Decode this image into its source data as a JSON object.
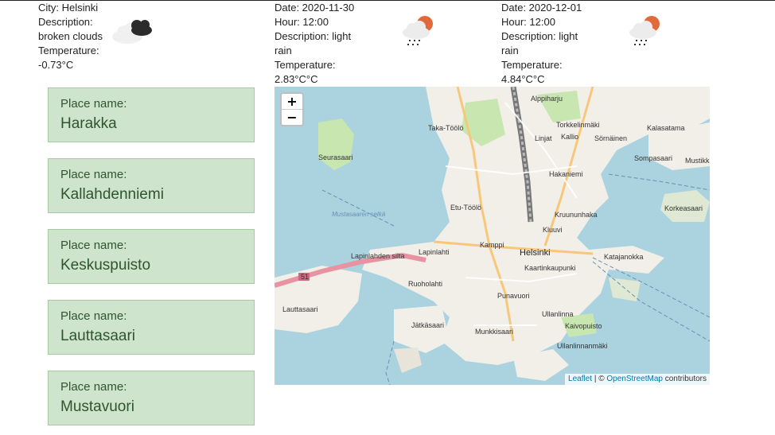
{
  "current": {
    "city": "City: Helsinki",
    "desc_label": "Description:",
    "desc_value": "broken clouds",
    "temp_label": "Temperature:",
    "temp_value": "-0.73°C",
    "icon": "broken-clouds-icon"
  },
  "forecast": [
    {
      "date": "Date: 2020-11-30",
      "hour": "Hour: 12:00",
      "desc_line1": "Description: light",
      "desc_line2": "rain",
      "temp_label": "Temperature:",
      "temp_value": "2.83°C°C",
      "icon": "light-rain-icon"
    },
    {
      "date": "Date: 2020-12-01",
      "hour": "Hour: 12:00",
      "desc_line1": "Description: light",
      "desc_line2": "rain",
      "temp_label": "Temperature:",
      "temp_value": "4.84°C°C",
      "icon": "light-rain-icon"
    }
  ],
  "places": [
    {
      "label": "Place name:",
      "name": "Harakka"
    },
    {
      "label": "Place name:",
      "name": "Kallahdenniemi"
    },
    {
      "label": "Place name:",
      "name": "Keskuspuisto"
    },
    {
      "label": "Place name:",
      "name": "Lauttasaari"
    },
    {
      "label": "Place name:",
      "name": "Mustavuori"
    }
  ],
  "map": {
    "zoom_in": "+",
    "zoom_out": "−",
    "attribution_leaflet": "Leaflet",
    "attribution_sep": " | © ",
    "attribution_osm": "OpenStreetMap",
    "attribution_tail": " contributors",
    "labels": {
      "alppiharju": "Alppiharju",
      "taka_toolo": "Taka-Töölö",
      "torkkelinmaki": "Torkkelinmäki",
      "kalasatama": "Kalasatama",
      "linjat": "Linjat",
      "kallio": "Kallio",
      "sornainen": "Sörnäinen",
      "seurasaari": "Seurasaari",
      "sompasaari": "Sompasaari",
      "mustikkamaa": "Mustikka",
      "hakaniemi": "Hakaniemi",
      "etu_toolo": "Etu-Töölö",
      "kruununhaka": "Kruununhaka",
      "korkeasaari": "Korkeasaari",
      "kluuvi": "Kluuvi",
      "lapinlahti": "Lapinlahti",
      "kamppi": "Kamppi",
      "helsinki": "Helsinki",
      "katajanokka": "Katajanokka",
      "kaartinkaupunki": "Kaartinkaupunki",
      "ruoholahti": "Ruoholahti",
      "lauttasaari": "Lauttasaari",
      "punavuori": "Punavuori",
      "ullanlinna": "Ullanlinna",
      "jatkasaari": "Jätkäsaari",
      "kaivopuisto": "Kaivopuisto",
      "munkkisaari": "Munkkisaari",
      "ullanlinnanmaki": "Ullanlinnanmäki",
      "road_51": "51",
      "mustasaaren": "Mustasaaren selkä",
      "lapinlahden_silta": "Lapinlahden silta"
    }
  },
  "colors": {
    "card_bg": "#cfe4cc",
    "card_text": "#2f5530",
    "water": "#aad3df",
    "land": "#f2efe9",
    "park": "#c8e6b0",
    "sun": "#e06a3c"
  }
}
